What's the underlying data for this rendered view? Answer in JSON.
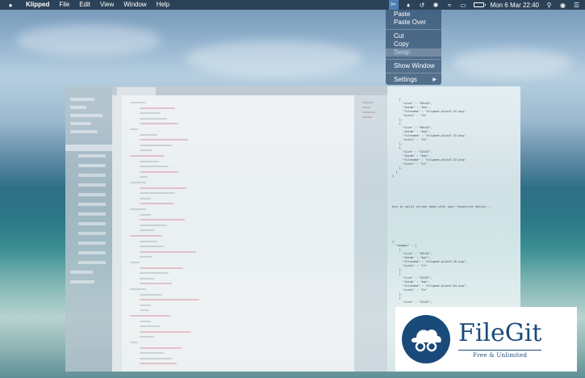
{
  "menubar": {
    "app_name": "Klipped",
    "menus": [
      "File",
      "Edit",
      "View",
      "Window",
      "Help"
    ],
    "clock": "Mon 6 Mar  22:40"
  },
  "dropdown": {
    "paste": "Paste",
    "paste_over": "Paste Over",
    "cut": "Cut",
    "copy": "Copy",
    "swap": "Swap",
    "show_window": "Show Window",
    "settings": "Settings"
  },
  "preview": {
    "code_top": "    {\n      \"size\" : \"36x10\",\n      \"idiom\" : \"mac\",\n      \"filename\" : \"klipped-plain3-32.png\",\n      \"scale\" : \"2x\"\n    },\n    {\n      \"size\" : \"96x10\",\n      \"idiom\" : \"mac\",\n      \"filename\" : \"klipped-plain3-32.png\",\n      \"scale\" : \"2x\"\n    },\n    {\n      \"size\" : \"32x32\",\n      \"idiom\" : \"mac\",\n      \"filename\" : \"klipped-plain3-32.png\",\n      \"scale\" : \"1x\"\n    },\n  ],\n}",
    "note": "Use in split screen mode with your favourite editor...",
    "code_bottom": "{\n  \"images\" : [\n    {\n      \"size\" : \"36x10\",\n      \"idiom\" : \"mac\",\n      \"filename\" : \"klipped-plain3-16.png\",\n      \"scale\" : \"1x\"\n    },\n    {\n      \"size\" : \"32x32\",\n      \"idiom\" : \"mac\",\n      \"filename\" : \"klipped-plain3-64.png\",\n      \"scale\" : \"2x\"\n    },\n    {\n      \"size\" : \"32x32\","
  },
  "watermark": {
    "name": "FileGit",
    "tagline": "Free & Unlimited"
  },
  "colors": {
    "accent": "#4d7fb3",
    "watermark_blue": "#1a4a7a"
  }
}
